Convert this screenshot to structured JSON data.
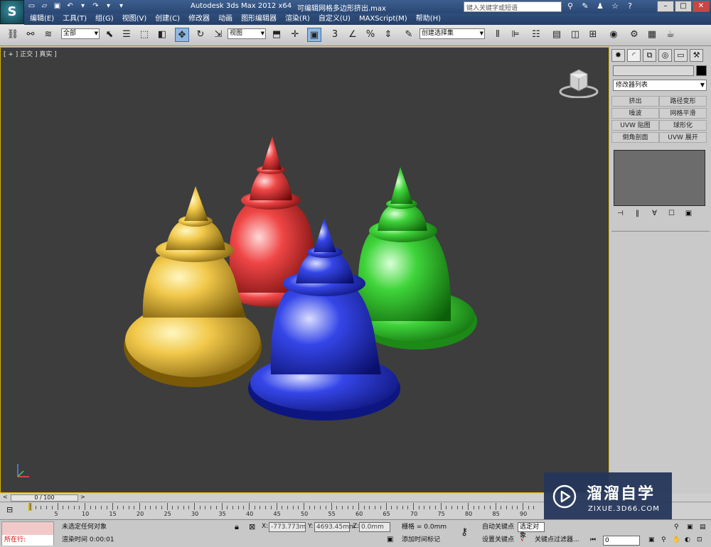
{
  "titlebar": {
    "app_title": "Autodesk 3ds Max  2012 x64",
    "file_title": "可编辑网格多边形挤出.max",
    "search_placeholder": "键入关键字或短语"
  },
  "menu": [
    "编辑(E)",
    "工具(T)",
    "组(G)",
    "视图(V)",
    "创建(C)",
    "修改器",
    "动画",
    "图形编辑器",
    "渲染(R)",
    "自定义(U)",
    "MAXScript(M)",
    "帮助(H)"
  ],
  "toolbar": {
    "selection_filter": "全部",
    "ref_coord": "视图",
    "named_selection": "创建选择集"
  },
  "viewport": {
    "label": "[ + ] 正交 ] 真实 ]"
  },
  "command_panel": {
    "modifier_list": "修改器列表",
    "modifier_buttons": [
      "挤出",
      "路径变形",
      "噪波",
      "网格平滑",
      "UVW 贴图",
      "球形化",
      "倒角剖面",
      "UVW 展开"
    ]
  },
  "time_slider": {
    "frame_display": "0 / 100",
    "ticks": [
      "5",
      "10",
      "15",
      "20",
      "25",
      "30",
      "35",
      "40",
      "45",
      "50",
      "55",
      "60",
      "65",
      "70",
      "75",
      "80",
      "85",
      "90"
    ]
  },
  "status": {
    "maxscript_line": "所在行:",
    "selection_msg": "未选定任何对象",
    "render_time": "渲染时间  0:00:01",
    "x_label": "X:",
    "x_value": "-773.773m",
    "y_label": "Y:",
    "y_value": "4693.45mm",
    "z_label": "Z:",
    "z_value": "0.0mm",
    "grid": "栅格 = 0.0mm",
    "add_time_tag": "添加时间标记",
    "auto_key": "自动关键点",
    "selected_obj": "选定对象",
    "set_key": "设置关键点",
    "key_filter": "关键点过滤器...",
    "frame": "0"
  },
  "watermark": {
    "name": "溜溜自学",
    "url": "ZIXUE.3D66.COM"
  }
}
